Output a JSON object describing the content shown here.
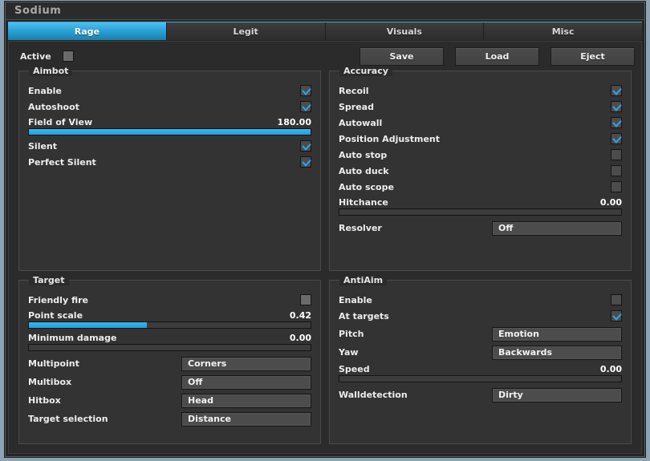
{
  "window": {
    "title": "Sodium"
  },
  "tabs": [
    {
      "label": "Rage",
      "active": true
    },
    {
      "label": "Legit",
      "active": false
    },
    {
      "label": "Visuals",
      "active": false
    },
    {
      "label": "Misc",
      "active": false
    }
  ],
  "toolbar": {
    "active_label": "Active",
    "active_checked": false,
    "save_label": "Save",
    "load_label": "Load",
    "eject_label": "Eject"
  },
  "panels": {
    "aimbot": {
      "title": "Aimbot",
      "enable_label": "Enable",
      "autoshoot_label": "Autoshoot",
      "fov_label": "Field of View",
      "fov_value": "180.00",
      "fov_percent": 100,
      "silent_label": "Silent",
      "perfect_silent_label": "Perfect Silent"
    },
    "accuracy": {
      "title": "Accuracy",
      "recoil_label": "Recoil",
      "spread_label": "Spread",
      "autowall_label": "Autowall",
      "position_adjustment_label": "Position Adjustment",
      "auto_stop_label": "Auto stop",
      "auto_duck_label": "Auto duck",
      "auto_scope_label": "Auto scope",
      "hitchance_label": "Hitchance",
      "hitchance_value": "0.00",
      "hitchance_percent": 0,
      "resolver_label": "Resolver",
      "resolver_value": "Off"
    },
    "target": {
      "title": "Target",
      "friendly_fire_label": "Friendly fire",
      "point_scale_label": "Point scale",
      "point_scale_value": "0.42",
      "point_scale_percent": 42,
      "minimum_damage_label": "Minimum damage",
      "minimum_damage_value": "0.00",
      "minimum_damage_percent": 0,
      "multipoint_label": "Multipoint",
      "multipoint_value": "Corners",
      "multibox_label": "Multibox",
      "multibox_value": "Off",
      "hitbox_label": "Hitbox",
      "hitbox_value": "Head",
      "target_selection_label": "Target selection",
      "target_selection_value": "Distance"
    },
    "antiaim": {
      "title": "AntiAim",
      "enable_label": "Enable",
      "at_targets_label": "At targets",
      "pitch_label": "Pitch",
      "pitch_value": "Emotion",
      "yaw_label": "Yaw",
      "yaw_value": "Backwards",
      "speed_label": "Speed",
      "speed_value": "0.00",
      "speed_percent": 0,
      "walldetection_label": "Walldetection",
      "walldetection_value": "Dirty"
    }
  },
  "colors": {
    "accent": "#2ba3d8",
    "panel_bg": "#333333",
    "window_bg": "#2b2b2b",
    "desktop_bg": "#8ba4b7"
  }
}
